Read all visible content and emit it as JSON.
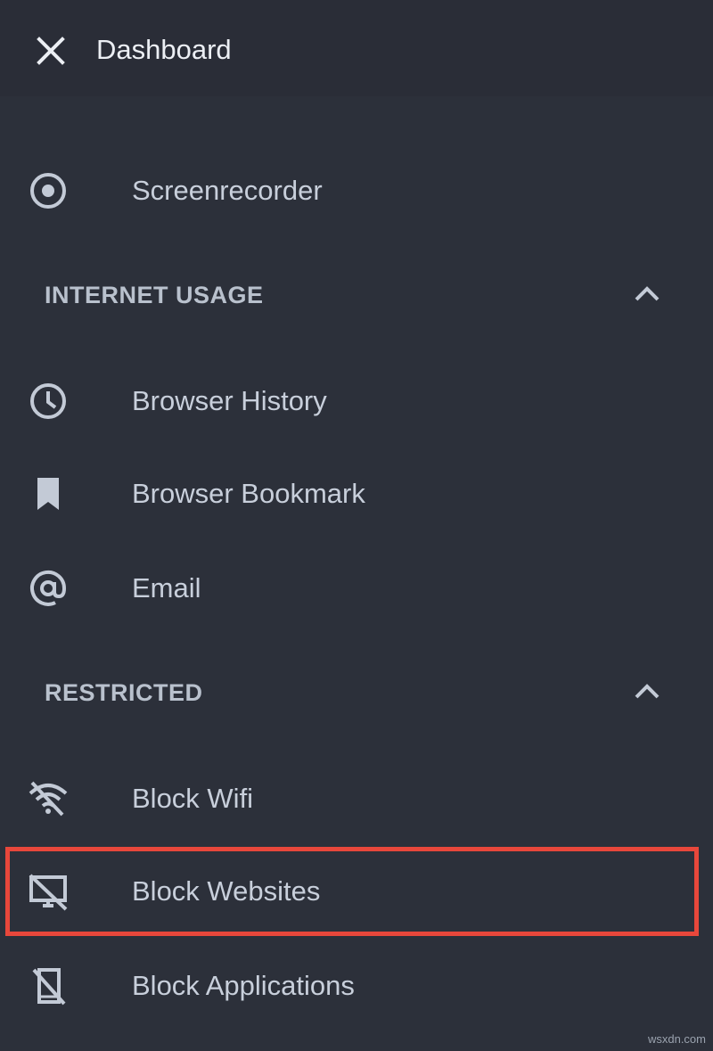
{
  "header": {
    "title": "Dashboard",
    "close_icon": "close-icon"
  },
  "top_items": [
    {
      "label": "Screenrecorder",
      "icon": "record-icon"
    }
  ],
  "sections": [
    {
      "title": "INTERNET USAGE",
      "expanded": true,
      "items": [
        {
          "label": "Browser History",
          "icon": "clock-icon"
        },
        {
          "label": "Browser Bookmark",
          "icon": "bookmark-icon"
        },
        {
          "label": "Email",
          "icon": "at-icon"
        }
      ]
    },
    {
      "title": "RESTRICTED",
      "expanded": true,
      "items": [
        {
          "label": "Block Wifi",
          "icon": "wifi-off-icon"
        },
        {
          "label": "Block Websites",
          "icon": "desktop-off-icon",
          "highlighted": true
        },
        {
          "label": "Block Applications",
          "icon": "phone-off-icon"
        }
      ]
    }
  ],
  "colors": {
    "background": "#2c303a",
    "header_background": "#2a2d37",
    "text": "#c8cfdb",
    "section_text": "#b9c1cd",
    "highlight": "#e8473b"
  },
  "watermark": "wsxdn.com"
}
